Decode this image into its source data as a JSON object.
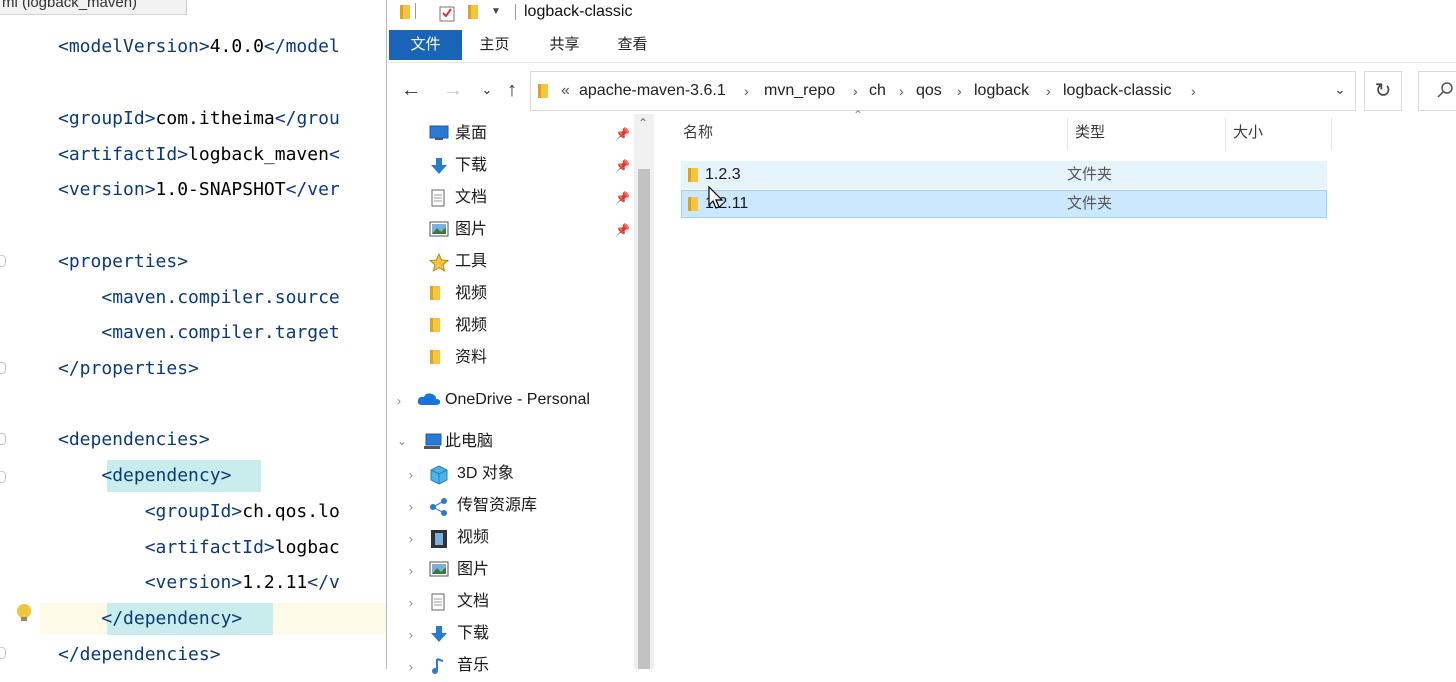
{
  "ide": {
    "tab_title": "ml (logback_maven)",
    "code_lines": [
      {
        "indent": "",
        "parts": [
          {
            "t": "<modelVersion>",
            "tag": true
          },
          {
            "t": "4.0.0",
            "tag": false
          },
          {
            "t": "</model",
            "tag": true
          }
        ]
      },
      {
        "indent": "",
        "parts": []
      },
      {
        "indent": "",
        "parts": [
          {
            "t": "<groupId>",
            "tag": true
          },
          {
            "t": "com.itheima",
            "tag": false
          },
          {
            "t": "</grou",
            "tag": true
          }
        ]
      },
      {
        "indent": "",
        "parts": [
          {
            "t": "<artifactId>",
            "tag": true
          },
          {
            "t": "logback_maven",
            "tag": false
          },
          {
            "t": "<",
            "tag": true
          }
        ]
      },
      {
        "indent": "",
        "parts": [
          {
            "t": "<version>",
            "tag": true
          },
          {
            "t": "1.0-SNAPSHOT",
            "tag": false
          },
          {
            "t": "</ver",
            "tag": true
          }
        ]
      },
      {
        "indent": "",
        "parts": []
      },
      {
        "indent": "",
        "parts": [
          {
            "t": "<properties>",
            "tag": true
          }
        ]
      },
      {
        "indent": "    ",
        "parts": [
          {
            "t": "<maven.compiler.source",
            "tag": true
          }
        ]
      },
      {
        "indent": "    ",
        "parts": [
          {
            "t": "<maven.compiler.target",
            "tag": true
          }
        ]
      },
      {
        "indent": "",
        "parts": [
          {
            "t": "</properties>",
            "tag": true
          }
        ]
      },
      {
        "indent": "",
        "parts": []
      },
      {
        "indent": "",
        "parts": [
          {
            "t": "<dependencies>",
            "tag": true
          }
        ]
      },
      {
        "indent": "    ",
        "parts": [
          {
            "t": "<dependency>",
            "tag": true
          }
        ]
      },
      {
        "indent": "        ",
        "parts": [
          {
            "t": "<groupId>",
            "tag": true
          },
          {
            "t": "ch.qos.lo",
            "tag": false
          }
        ]
      },
      {
        "indent": "        ",
        "parts": [
          {
            "t": "<artifactId>",
            "tag": true
          },
          {
            "t": "logbac",
            "tag": false
          }
        ]
      },
      {
        "indent": "        ",
        "parts": [
          {
            "t": "<version>",
            "tag": true
          },
          {
            "t": "1.2.11",
            "tag": false
          },
          {
            "t": "</v",
            "tag": true
          }
        ]
      },
      {
        "indent": "    ",
        "parts": [
          {
            "t": "</dependency>",
            "tag": true
          }
        ]
      },
      {
        "indent": "",
        "parts": [
          {
            "t": "</dependencies>",
            "tag": true
          }
        ]
      }
    ]
  },
  "explorer": {
    "window_title": "logback-classic",
    "ribbon_tabs": {
      "file": "文件",
      "home": "主页",
      "share": "共享",
      "view": "查看"
    },
    "breadcrumb_prefix": "«",
    "breadcrumb": [
      "apache-maven-3.6.1",
      "mvn_repo",
      "ch",
      "qos",
      "logback",
      "logback-classic"
    ],
    "nav_items": {
      "desktop": "桌面",
      "downloads": "下载",
      "documents": "文档",
      "pictures": "图片",
      "tools": "工具",
      "video1": "视频",
      "video2": "视频",
      "materials": "资料",
      "onedrive": "OneDrive - Personal",
      "this_pc": "此电脑",
      "objects3d": "3D 对象",
      "chuanzhi": "传智资源库",
      "pc_videos": "视频",
      "pc_pictures": "图片",
      "pc_documents": "文档",
      "pc_downloads": "下载",
      "pc_music": "音乐"
    },
    "columns": {
      "name": "名称",
      "type": "类型",
      "size": "大小"
    },
    "files": [
      {
        "name": "1.2.3",
        "type": "文件夹"
      },
      {
        "name": "1.2.11",
        "type": "文件夹"
      }
    ]
  },
  "colors": {
    "ribbon_file_tab": "#1a64b8",
    "selection": "#cce8ff",
    "folder": "#f5c542",
    "tag": "#0a3a7a"
  }
}
